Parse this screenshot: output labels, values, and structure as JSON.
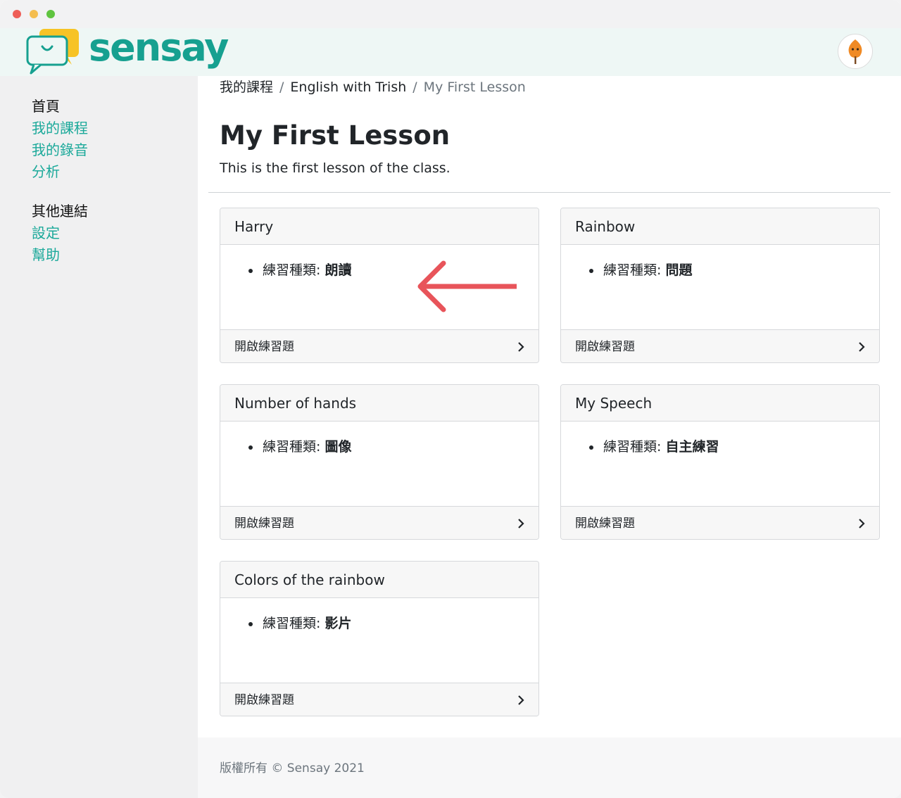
{
  "brand": {
    "name": "sensay",
    "primary_color": "#1ba99a",
    "logo_color": "#16a090",
    "bubble_yellow": "#f7c325"
  },
  "sidebar": {
    "groups": [
      {
        "heading": "首頁",
        "links": [
          "我的課程",
          "我的錄音",
          "分析"
        ]
      },
      {
        "heading": "其他連結",
        "links": [
          "設定",
          "幫助"
        ]
      }
    ]
  },
  "breadcrumb": {
    "items": [
      "我的課程",
      "English with Trish"
    ],
    "current": "My First Lesson",
    "separator": "/"
  },
  "page": {
    "title": "My First Lesson",
    "description": "This is the first lesson of the class."
  },
  "cards": [
    {
      "title": "Harry",
      "item_label": "練習種類:",
      "item_value": "朗讀",
      "footer": "開啟練習題"
    },
    {
      "title": "Rainbow",
      "item_label": "練習種類:",
      "item_value": "問題",
      "footer": "開啟練習題"
    },
    {
      "title": "Number of hands",
      "item_label": "練習種類:",
      "item_value": "圖像",
      "footer": "開啟練習題"
    },
    {
      "title": "My Speech",
      "item_label": "練習種類:",
      "item_value": "自主練習",
      "footer": "開啟練習題"
    },
    {
      "title": "Colors of the rainbow",
      "item_label": "練習種類:",
      "item_value": "影片",
      "footer": "開啟練習題"
    }
  ],
  "footer": {
    "copyright": "版權所有 © Sensay 2021"
  },
  "annotation": {
    "arrow_color": "#e8545a"
  }
}
